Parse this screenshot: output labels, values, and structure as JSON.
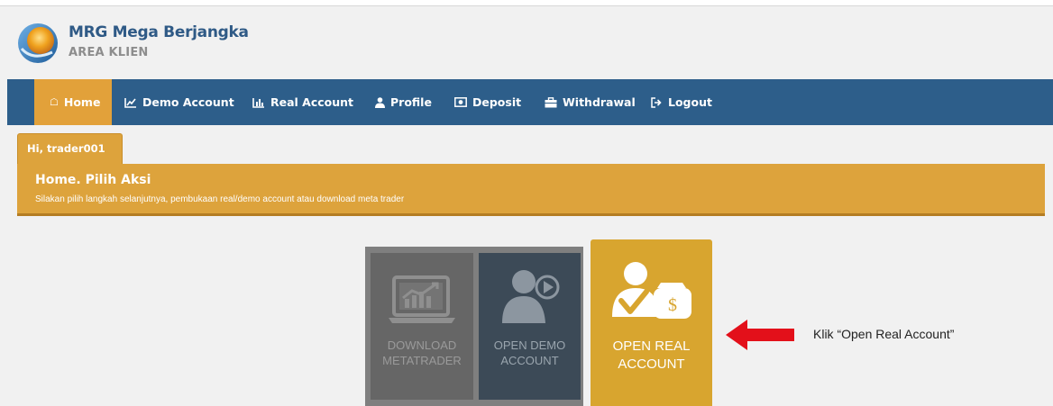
{
  "brand": {
    "title": "MRG Mega Berjangka",
    "subtitle": "AREA KLIEN",
    "logo_icon": "globe-logo-icon"
  },
  "nav": {
    "items": [
      {
        "label": "Home",
        "icon": "home-icon",
        "active": true
      },
      {
        "label": "Demo Account",
        "icon": "line-chart-icon",
        "active": false
      },
      {
        "label": "Real Account",
        "icon": "bar-chart-icon",
        "active": false
      },
      {
        "label": "Profile",
        "icon": "user-icon",
        "active": false
      },
      {
        "label": "Deposit",
        "icon": "money-icon",
        "active": false
      },
      {
        "label": "Withdrawal",
        "icon": "briefcase-icon",
        "active": false
      },
      {
        "label": "Logout",
        "icon": "sign-out-icon",
        "active": false
      }
    ]
  },
  "greeting": {
    "label": "Hi, trader001"
  },
  "banner": {
    "title": "Home. Pilih Aksi",
    "description": "Silakan pilih langkah selanjutnya, pembukaan real/demo account atau download meta trader"
  },
  "tiles": [
    {
      "line1": "DOWNLOAD",
      "line2": "METATRADER",
      "icon": "laptop-chart-icon"
    },
    {
      "line1": "OPEN DEMO",
      "line2": "ACCOUNT",
      "icon": "user-play-icon"
    },
    {
      "line1": "OPEN REAL",
      "line2": "ACCOUNT",
      "icon": "user-money-icon"
    }
  ],
  "annotation": {
    "text": "Klik “Open Real Account”",
    "arrow_icon": "red-arrow-left-icon"
  },
  "colors": {
    "navbar": "#2d5e8a",
    "accent": "#dda33c",
    "brand_title": "#2f5a86",
    "arrow": "#e3101a"
  }
}
